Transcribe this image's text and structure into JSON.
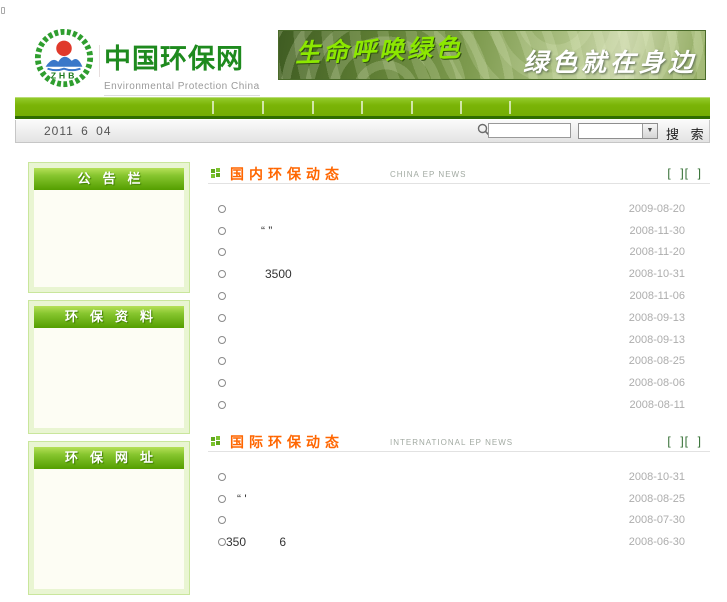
{
  "header": {
    "logo": {
      "text": "ZHB"
    },
    "site_title": "中国环保网",
    "site_subtitle": "Environmental Protection China",
    "banner": {
      "slogan_left": "生命呼唤绿色",
      "slogan_right": "绿色就在身边"
    }
  },
  "toolbar": {
    "date_text": "2011 6 04",
    "search_label": "搜 索",
    "select_arrow": "▼"
  },
  "sidebar": {
    "panels": [
      {
        "label": "公告栏"
      },
      {
        "label": "环保资料"
      },
      {
        "label": "环保网址"
      }
    ]
  },
  "sections": [
    {
      "title": "国内环保动态",
      "subtitle": "CHINA EP NEWS",
      "more": "[  ][  ]",
      "items": [
        {
          "fragment": "",
          "indent": 0,
          "date": "2009-08-20"
        },
        {
          "fragment": "“ ”",
          "indent": 27,
          "date": "2008-11-30"
        },
        {
          "fragment": "",
          "indent": 0,
          "date": "2008-11-20"
        },
        {
          "fragment": "3500",
          "indent": 31,
          "date": "2008-10-31"
        },
        {
          "fragment": "",
          "indent": 0,
          "date": "2008-11-06"
        },
        {
          "fragment": "",
          "indent": 0,
          "date": "2008-09-13"
        },
        {
          "fragment": "",
          "indent": 0,
          "date": "2008-09-13"
        },
        {
          "fragment": "",
          "indent": 0,
          "date": "2008-08-25"
        },
        {
          "fragment": "",
          "indent": 0,
          "date": "2008-08-06"
        },
        {
          "fragment": "",
          "indent": 0,
          "date": "2008-08-11"
        }
      ]
    },
    {
      "title": "国际环保动态",
      "subtitle": "INTERNATIONAL EP NEWS",
      "more": "[  ][  ]",
      "items": [
        {
          "fragment": "",
          "indent": 0,
          "date": "2008-10-31"
        },
        {
          "fragment": "“ '",
          "indent": 3,
          "date": "2008-08-25"
        },
        {
          "fragment": "",
          "indent": 0,
          "date": "2008-07-30"
        },
        {
          "fragment": "350          6",
          "indent": -8,
          "date": "2008-06-30"
        }
      ]
    }
  ],
  "colors": {
    "nav_green": "#7ab407",
    "title_green": "#1e8a1e",
    "section_orange": "#ff6600",
    "date_gray": "#adadad"
  }
}
